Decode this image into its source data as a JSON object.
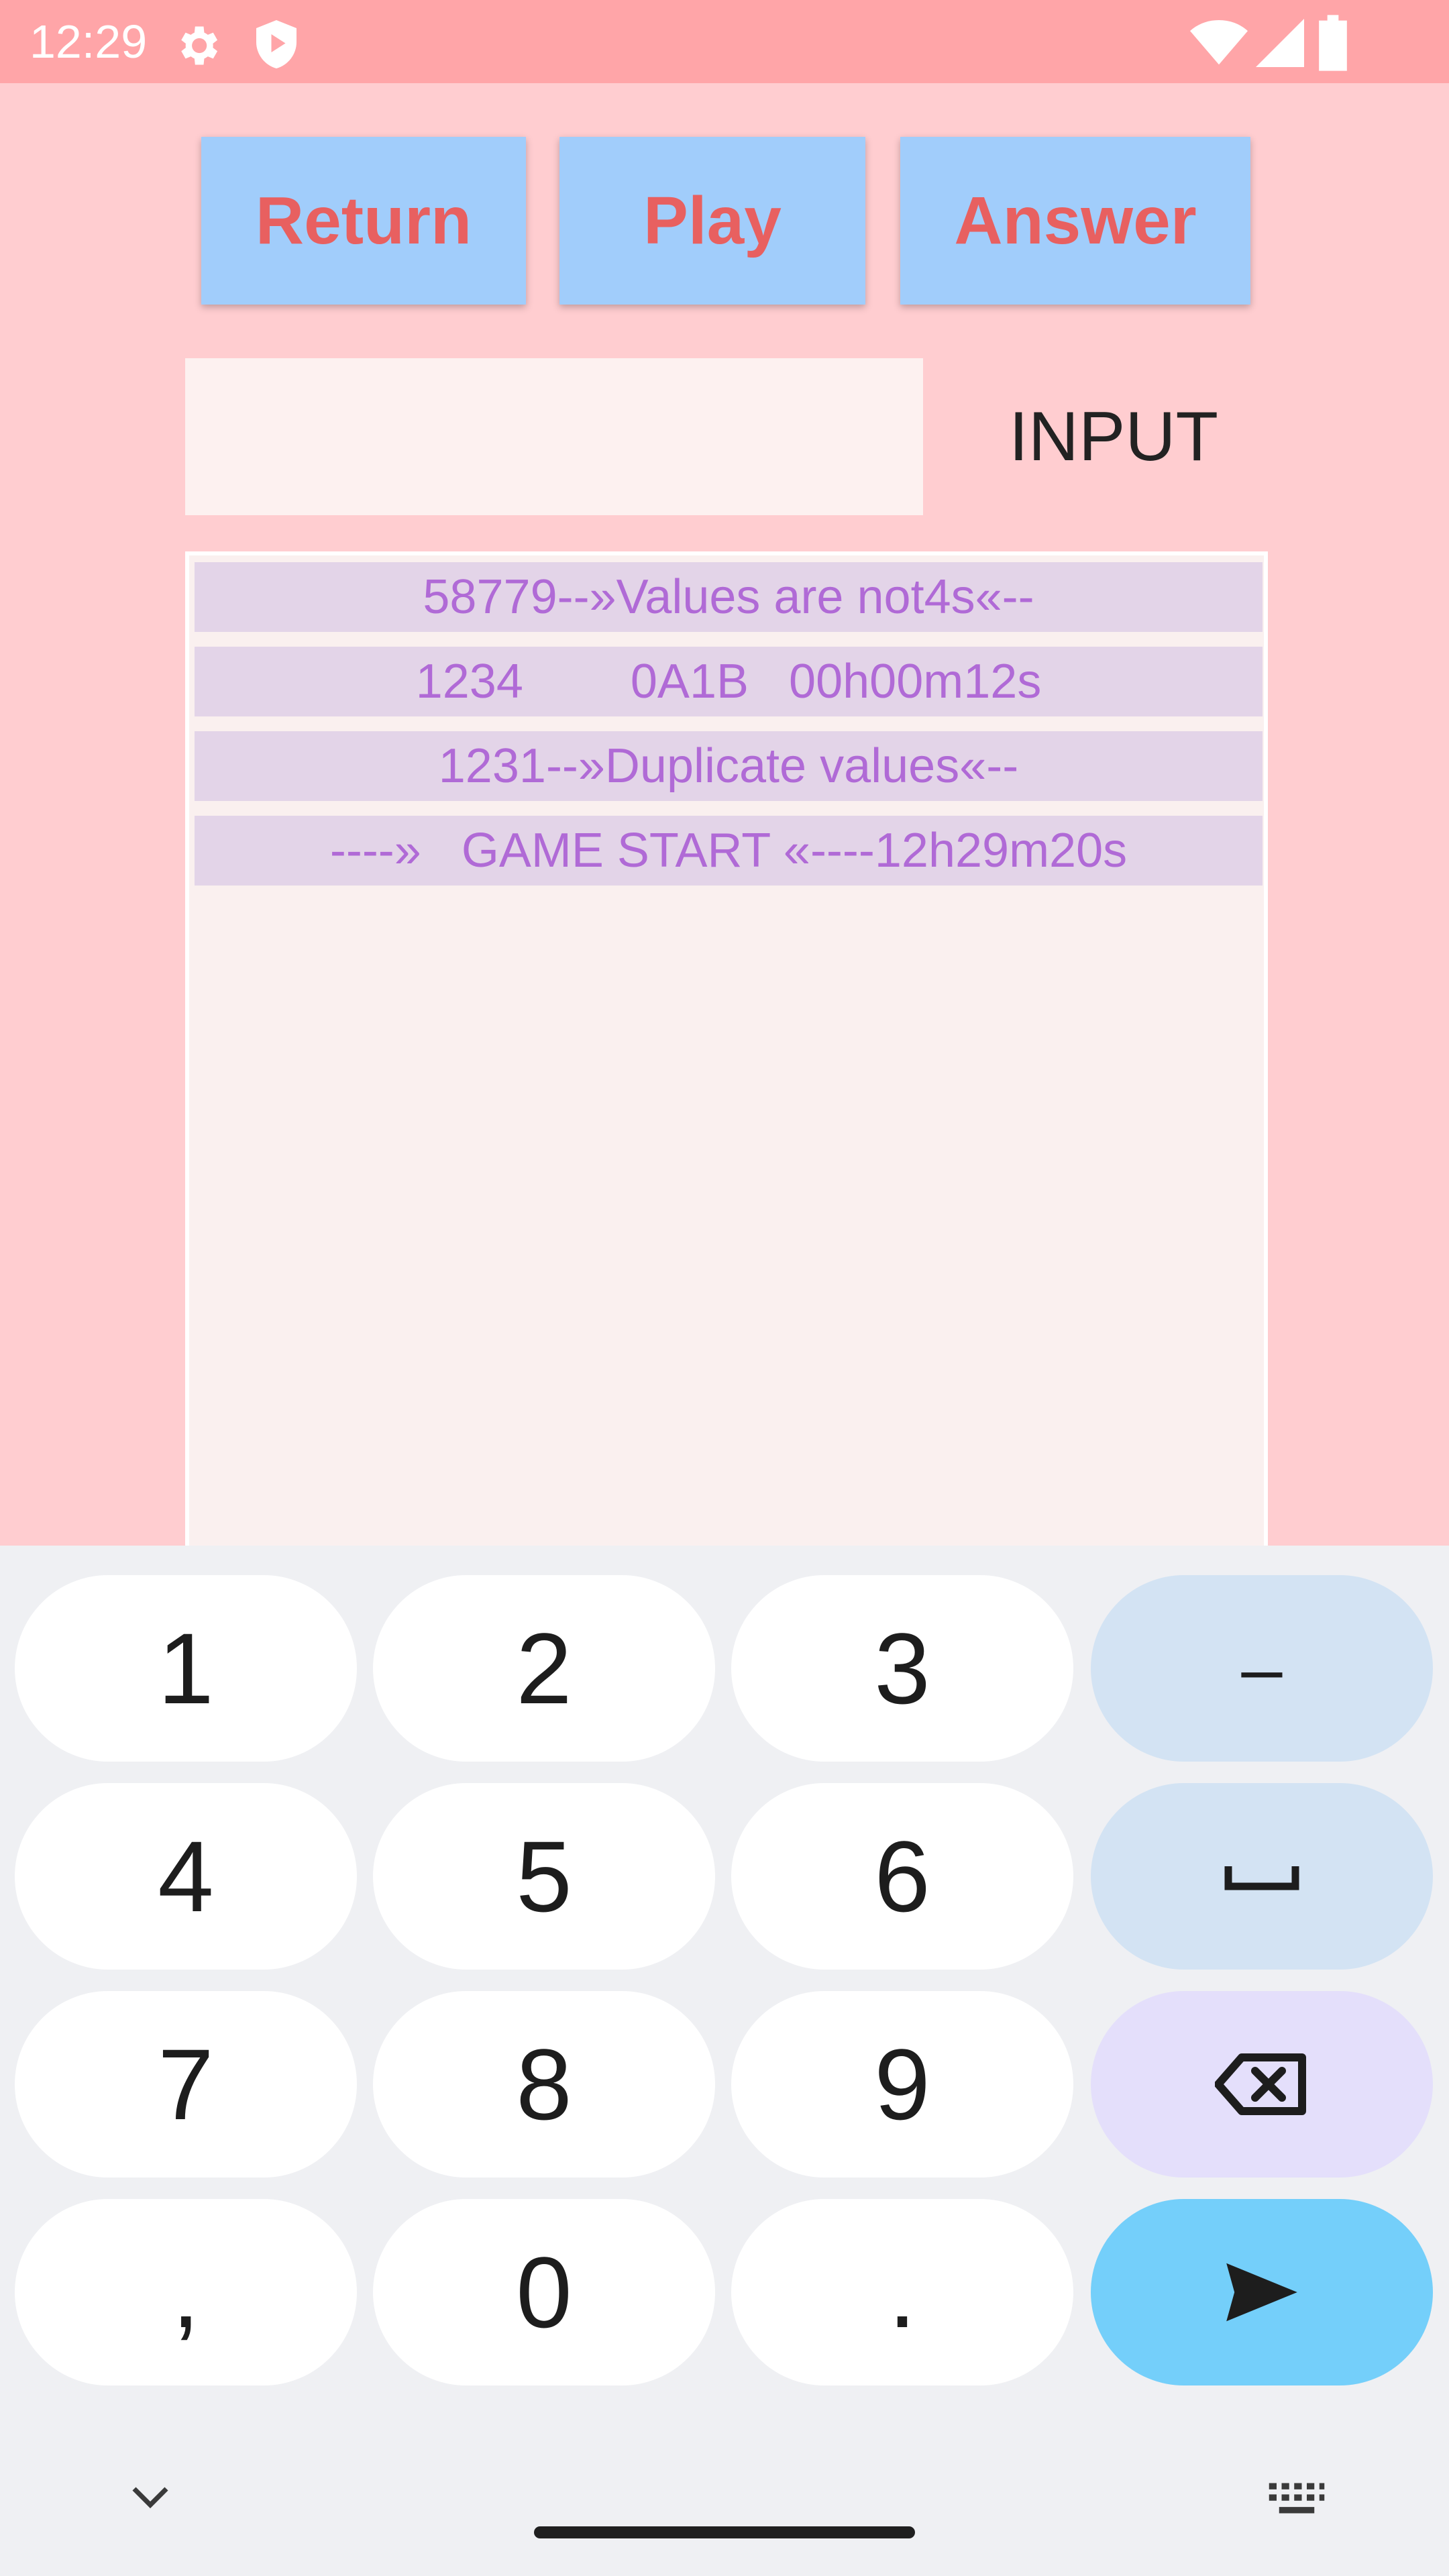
{
  "status_bar": {
    "time": "12:29",
    "icons": [
      "gear-icon",
      "shield-play-icon",
      "wifi-icon",
      "cellular-icon",
      "battery-icon"
    ]
  },
  "toolbar": {
    "return_label": "Return",
    "play_label": "Play",
    "answer_label": "Answer"
  },
  "input": {
    "value": "",
    "label": "INPUT"
  },
  "log": {
    "rows": [
      "58779--»Values are not4s«--",
      "1234        0A1B   00h00m12s",
      "1231--»Duplicate values«--",
      "----»   GAME START «----12h29m20s"
    ]
  },
  "keyboard": {
    "keys": [
      "1",
      "2",
      "3",
      "–",
      "4",
      "5",
      "6",
      "␣",
      "7",
      "8",
      "9",
      "backspace",
      ",",
      "0",
      ".",
      "send"
    ],
    "collapse_icon": "chevron-down-icon",
    "switch_icon": "keyboard-icon"
  },
  "colors": {
    "background": "#ffcdd0",
    "status_bar": "#ffa5a8",
    "button_bg": "#a1cdfb",
    "button_text": "#e86060",
    "log_row_bg": "#e3d4e8",
    "log_text": "#b06ad6",
    "send_key": "#74cffa"
  }
}
